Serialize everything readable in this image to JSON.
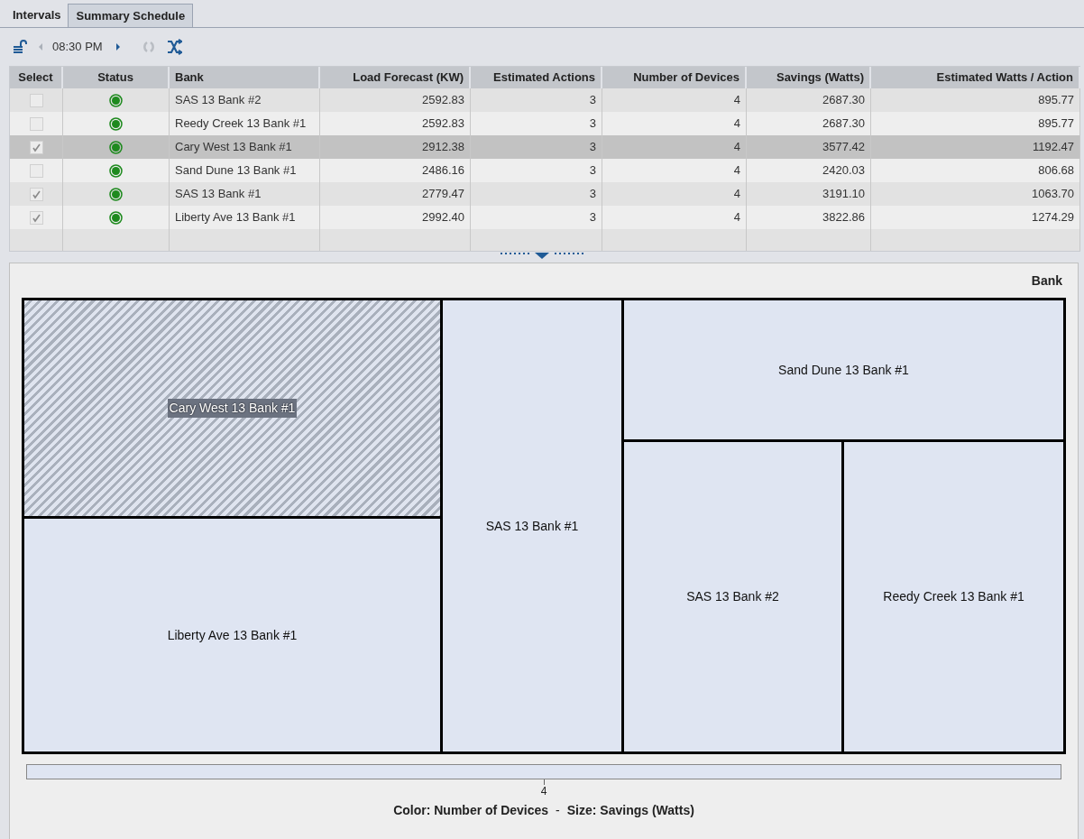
{
  "tabs": [
    {
      "label": "Intervals",
      "selected": true
    },
    {
      "label": "Summary Schedule",
      "selected": false
    }
  ],
  "toolbar": {
    "time": "08:30 PM"
  },
  "table": {
    "columns": [
      "Select",
      "Status",
      "Bank",
      "Load Forecast (KW)",
      "Estimated Actions",
      "Number of Devices",
      "Savings (Watts)",
      "Estimated Watts / Action"
    ],
    "rows": [
      {
        "checked": false,
        "selected": false,
        "color": "#1e8a1e",
        "bank": "SAS 13 Bank #2",
        "load_forecast": "2592.83",
        "estimated_actions": "3",
        "number_of_devices": "4",
        "savings": "2687.30",
        "watts_per_action": "895.77"
      },
      {
        "checked": false,
        "selected": false,
        "color": "#1e8a1e",
        "bank": "Reedy Creek 13 Bank #1",
        "load_forecast": "2592.83",
        "estimated_actions": "3",
        "number_of_devices": "4",
        "savings": "2687.30",
        "watts_per_action": "895.77"
      },
      {
        "checked": true,
        "selected": true,
        "color": "#1e8a1e",
        "bank": "Cary West 13 Bank #1",
        "load_forecast": "2912.38",
        "estimated_actions": "3",
        "number_of_devices": "4",
        "savings": "3577.42",
        "watts_per_action": "1192.47"
      },
      {
        "checked": false,
        "selected": false,
        "color": "#1e8a1e",
        "bank": "Sand Dune 13 Bank #1",
        "load_forecast": "2486.16",
        "estimated_actions": "3",
        "number_of_devices": "4",
        "savings": "2420.03",
        "watts_per_action": "806.68"
      },
      {
        "checked": true,
        "selected": false,
        "color": "#1e8a1e",
        "bank": "SAS 13 Bank #1",
        "load_forecast": "2779.47",
        "estimated_actions": "3",
        "number_of_devices": "4",
        "savings": "3191.10",
        "watts_per_action": "1063.70"
      },
      {
        "checked": true,
        "selected": false,
        "color": "#1e8a1e",
        "bank": "Liberty Ave 13 Bank #1",
        "load_forecast": "2992.40",
        "estimated_actions": "3",
        "number_of_devices": "4",
        "savings": "3822.86",
        "watts_per_action": "1274.29"
      }
    ]
  },
  "treemap": {
    "title": "Bank",
    "tiles": [
      {
        "label": "Cary West 13 Bank #1",
        "selected": true
      },
      {
        "label": "Liberty Ave 13 Bank #1",
        "selected": false
      },
      {
        "label": "SAS 13 Bank #1",
        "selected": false
      },
      {
        "label": "Sand Dune 13 Bank #1",
        "selected": false
      },
      {
        "label": "SAS 13 Bank #2",
        "selected": false
      },
      {
        "label": "Reedy Creek 13 Bank #1",
        "selected": false
      }
    ],
    "legend_tick": "4",
    "color_label": "Color: Number of Devices",
    "separator": "-",
    "size_label": "Size: Savings (Watts)"
  }
}
